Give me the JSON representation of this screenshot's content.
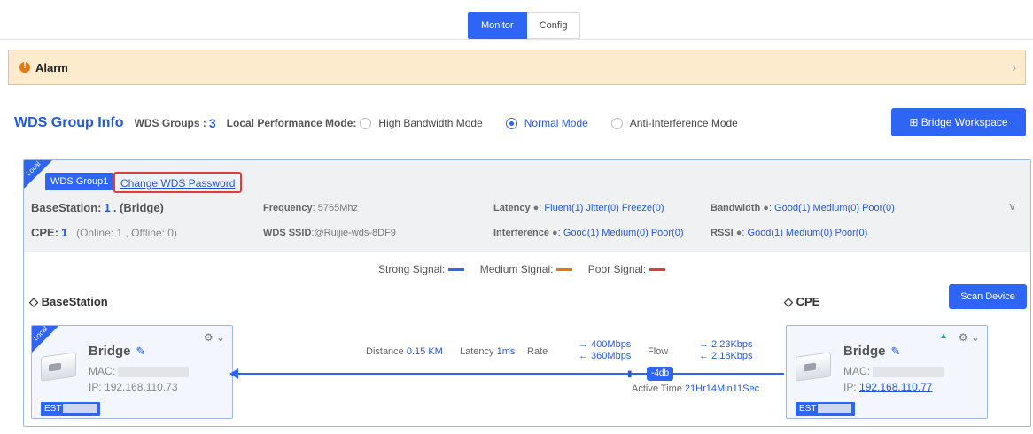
{
  "tabs": {
    "monitor": "Monitor",
    "config": "Config"
  },
  "alarm": {
    "title": "Alarm",
    "chevron": "›"
  },
  "wds": {
    "title": "WDS Group Info",
    "groups_label": "WDS Groups :",
    "groups_count": "3",
    "perf_label": "Local Performance Mode:",
    "modes": [
      "High Bandwidth Mode",
      "Normal Mode",
      "Anti-Interference Mode"
    ],
    "selected_mode": "Normal Mode",
    "workspace_button": "⊞ Bridge Workspace"
  },
  "group": {
    "ribbon": "Local",
    "name": "WDS Group1",
    "change_password": "Change WDS Password",
    "basestation_label": "BaseStation:",
    "basestation_count": "1",
    "basestation_suffix": ". (Bridge)",
    "cpe_label": "CPE:",
    "cpe_count": "1",
    "cpe_suffix": ". (Online: 1 , Offline: 0)",
    "frequency_label": "Frequency",
    "frequency_value": ": 5765Mhz",
    "ssid_label": "WDS SSID",
    "ssid_value": ":@Ruijie-wds-8DF9",
    "latency_label": "Latency",
    "latency_values": ": Fluent(1)  Jitter(0)  Freeze(0)",
    "interference_label": "Interference",
    "interference_values": ": Good(1)  Medium(0)  Poor(0)",
    "bandwidth_label": "Bandwidth",
    "bandwidth_values": ": Good(1)  Medium(0)  Poor(0)",
    "rssi_label": "RSSI",
    "rssi_values": ": Good(1)  Medium(0)  Poor(0)",
    "collapse": "∨"
  },
  "legend": {
    "strong": "Strong Signal:",
    "medium": "Medium Signal:",
    "poor": "Poor Signal:",
    "colors": {
      "strong": "#2f65f5",
      "medium": "#e8780d",
      "poor": "#e23b3b"
    }
  },
  "basestation": {
    "section": "◇ BaseStation",
    "ribbon": "Local",
    "name": "Bridge",
    "mac_label": "MAC:",
    "ip_label": "IP:",
    "ip": "192.168.110.73",
    "est": "EST"
  },
  "cpe": {
    "section": "◇ CPE",
    "scan_button": "Scan Device",
    "name": "Bridge",
    "mac_label": "MAC:",
    "ip_label": "IP:",
    "ip": "192.168.110.77",
    "est": "EST"
  },
  "link": {
    "distance_label": "Distance",
    "distance_value": "0.15 KM",
    "latency_label": "Latency",
    "latency_value": "1ms",
    "rate_label": "Rate",
    "rate_up": "→ 400Mbps",
    "rate_down": "← 360Mbps",
    "flow_label": "Flow",
    "flow_up": "→ 2.23Kbps",
    "flow_down": "← 2.18Kbps",
    "signal": "-4db",
    "active_label": "Active Time",
    "active_value": "21Hr14Min11Sec"
  }
}
